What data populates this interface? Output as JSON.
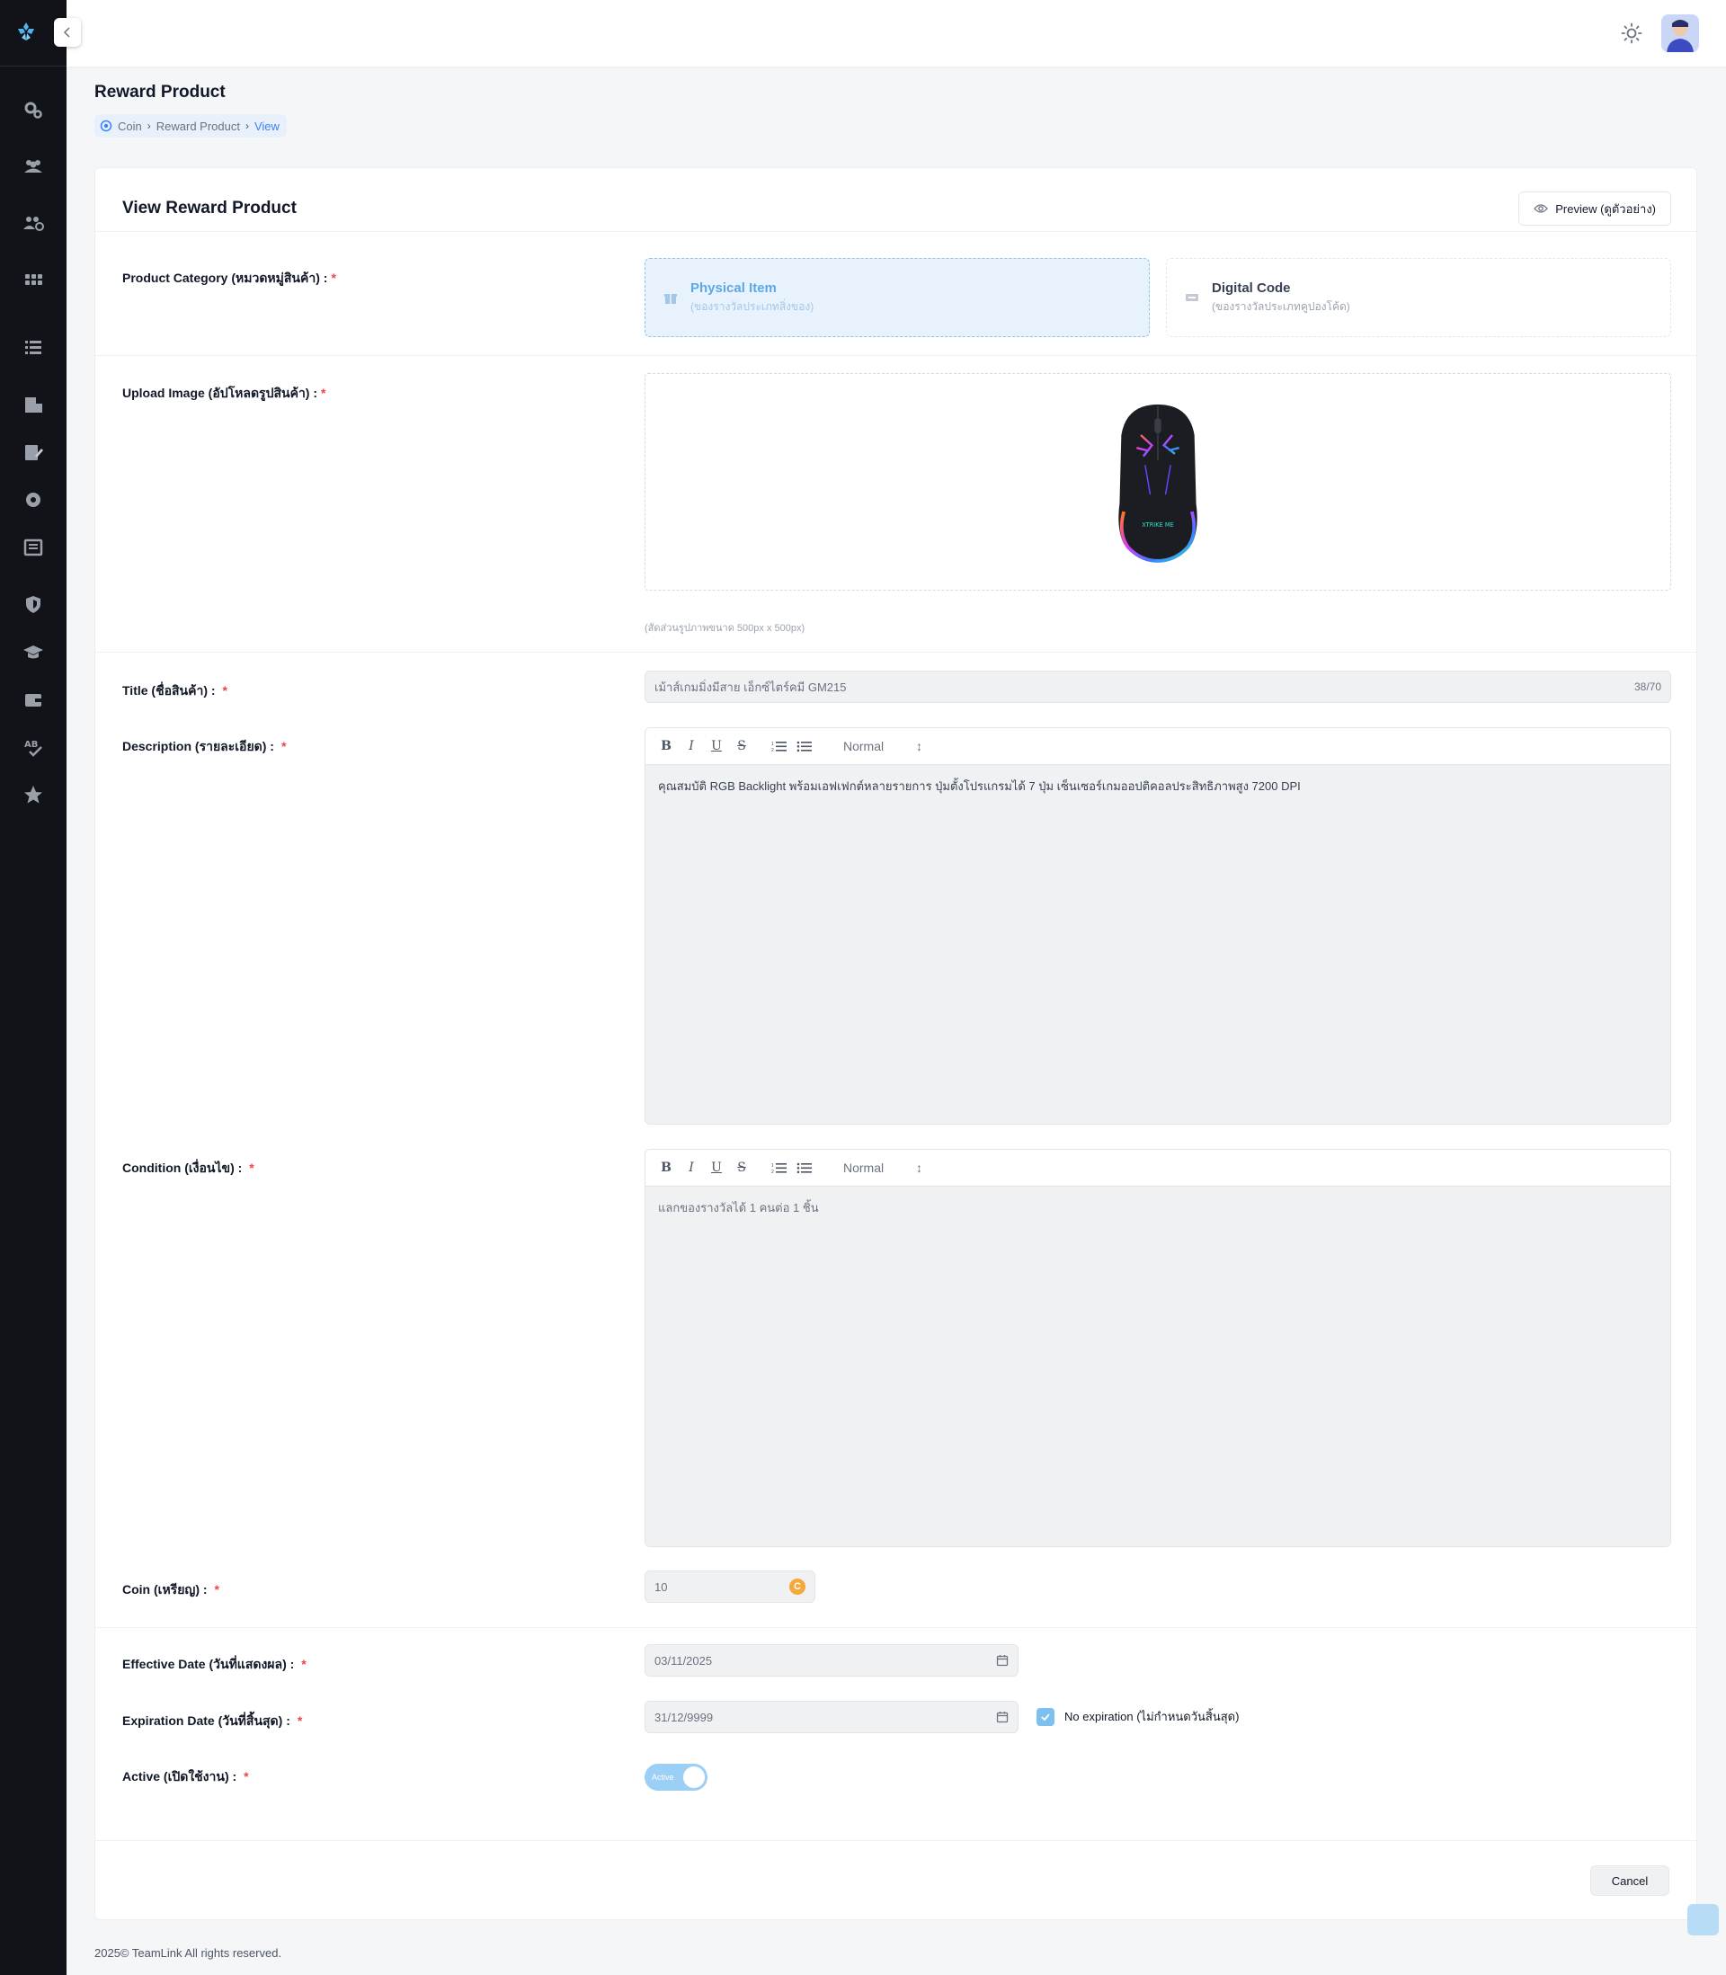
{
  "page": {
    "title": "Reward Product",
    "breadcrumb": [
      "Coin",
      "Reward Product",
      "View"
    ]
  },
  "card": {
    "title": "View Reward Product",
    "preview_label": "Preview (ดูตัวอย่าง)"
  },
  "form": {
    "category": {
      "label": "Product Category (หมวดหมู่สินค้า) :",
      "options": [
        {
          "title": "Physical Item",
          "subtitle": "(ของรางวัลประเภทสิ่งของ)",
          "selected": true
        },
        {
          "title": "Digital Code",
          "subtitle": "(ของรางวัลประเภทคูปองโค้ด)",
          "selected": false
        }
      ]
    },
    "image": {
      "label": "Upload Image (อัปโหลดรูปสินค้า) :",
      "hint": "(สัดส่วนรูปภาพขนาด 500px x 500px)"
    },
    "title": {
      "label": "Title (ชื่อสินค้า) :",
      "value": "เม้าส์เกมมิ่งมีสาย เอ็กซ์ไตร์คมี GM215",
      "counter": "38/70"
    },
    "description": {
      "label": "Description (รายละเอียด) :",
      "format": "Normal",
      "value": "คุณสมบัติ RGB Backlight พร้อมเอฟเฟกต์หลายรายการ ปุ่มตั้งโปรแกรมได้ 7 ปุ่ม เซ็นเซอร์เกมออปติคอลประสิทธิภาพสูง 7200 DPI"
    },
    "condition": {
      "label": "Condition (เงื่อนไข) :",
      "format": "Normal",
      "value": "แลกของรางวัลได้ 1 คนต่อ 1 ชิ้น"
    },
    "coin": {
      "label": "Coin (เหรียญ) :",
      "value": "10",
      "badge": "C"
    },
    "effective_date": {
      "label": "Effective Date (วันที่แสดงผล) :",
      "value": "03/11/2025"
    },
    "expiration_date": {
      "label": "Expiration Date (วันที่สิ้นสุด) :",
      "value": "31/12/9999",
      "no_expiration_label": "No expiration (ไม่กำหนดวันสิ้นสุด)",
      "no_expiration_checked": true
    },
    "active": {
      "label": "Active (เปิดใช้งาน) :",
      "toggle_text": "Active",
      "on": true
    },
    "required_mark": "*",
    "cancel_label": "Cancel"
  },
  "editor_toolbar": {
    "bold": "B",
    "italic": "I",
    "underline": "U",
    "strike": "S"
  },
  "footer": {
    "text": "2025© TeamLink All rights reserved."
  },
  "colors": {
    "sidebar": "#111318",
    "accent": "#3b82f6",
    "selected_bg": "#e8f2fc",
    "required": "#ef4444"
  },
  "icons": {
    "sidebar": [
      "settings-gears-icon",
      "users-icon",
      "user-group-icon",
      "apps-icon",
      "list-icon",
      "building-icon",
      "edit-document-icon",
      "badge-icon",
      "newspaper-icon",
      "shield-icon",
      "graduation-cap-icon",
      "wallet-icon",
      "spellcheck-icon",
      "star-icon"
    ]
  }
}
